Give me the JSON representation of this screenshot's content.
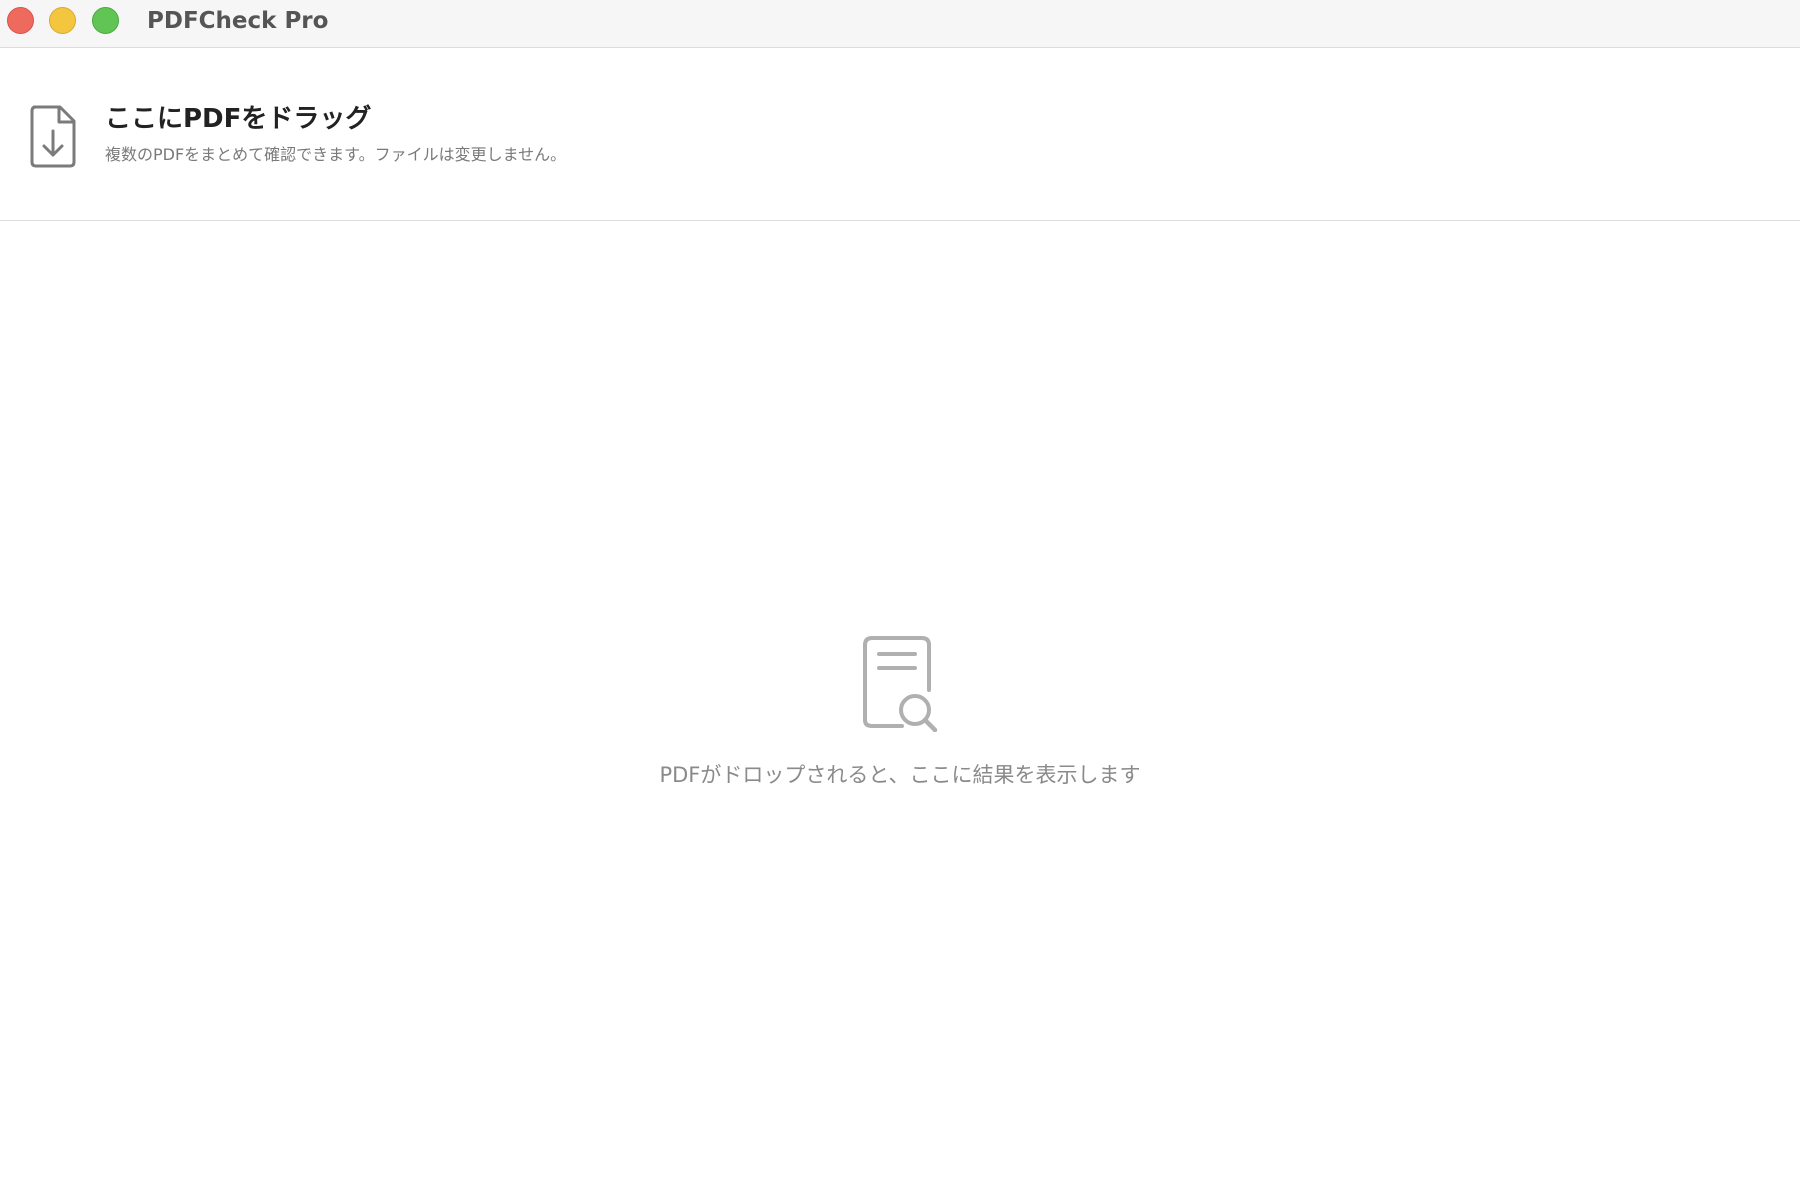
{
  "window": {
    "title": "PDFCheck Pro",
    "controls": {
      "close_color": "#ee6a5f",
      "minimize_color": "#f4c53f",
      "zoom_color": "#60c554"
    }
  },
  "dropzone": {
    "icon": "file-download-icon",
    "title": "ここにPDFをドラッグ",
    "subtitle": "複数のPDFをまとめて確認できます。ファイルは変更しません。"
  },
  "empty_state": {
    "icon": "document-search-icon",
    "message": "PDFがドロップされると、ここに結果を表示します"
  }
}
